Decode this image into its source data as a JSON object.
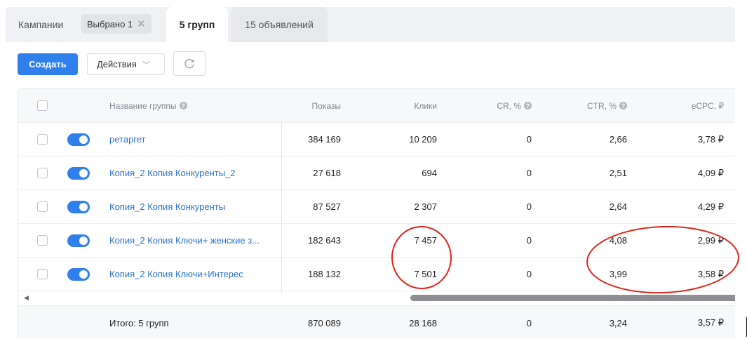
{
  "tabs": {
    "campaigns": "Кампании",
    "selected_chip": "Выбрано 1",
    "groups": "5 групп",
    "ads": "15 объявлений"
  },
  "toolbar": {
    "create": "Создать",
    "actions": "Действия"
  },
  "table": {
    "columns": {
      "name": "Название группы",
      "impressions": "Показы",
      "clicks": "Клики",
      "cr": "CR, %",
      "ctr": "CTR, %",
      "ecpc": "eCPC, ₽"
    },
    "rows": [
      {
        "name": "ретаргет",
        "impressions": "384 169",
        "clicks": "10 209",
        "cr": "0",
        "ctr": "2,66",
        "ecpc": "3,78 ₽",
        "enabled": true
      },
      {
        "name": "Копия_2 Копия Конкуренты_2",
        "impressions": "27 618",
        "clicks": "694",
        "cr": "0",
        "ctr": "2,51",
        "ecpc": "4,09 ₽",
        "enabled": true
      },
      {
        "name": "Копия_2 Копия Конкуренты",
        "impressions": "87 527",
        "clicks": "2 307",
        "cr": "0",
        "ctr": "2,64",
        "ecpc": "4,29 ₽",
        "enabled": true
      },
      {
        "name": "Копия_2 Копия Ключи+ женские з...",
        "impressions": "182 643",
        "clicks": "7 457",
        "cr": "0",
        "ctr": "4,08",
        "ecpc": "2,99 ₽",
        "enabled": true
      },
      {
        "name": "Копия_2 Копия Ключи+Интерес",
        "impressions": "188 132",
        "clicks": "7 501",
        "cr": "0",
        "ctr": "3,99",
        "ecpc": "3,58 ₽",
        "enabled": true
      }
    ],
    "footer": {
      "label": "Итого: 5 групп",
      "impressions": "870 089",
      "clicks": "28 168",
      "cr": "0",
      "ctr": "3,24",
      "ecpc": "3,57 ₽"
    }
  },
  "colors": {
    "accent": "#2f80ed",
    "link": "#2a73c9",
    "annotation": "#e0231b"
  }
}
